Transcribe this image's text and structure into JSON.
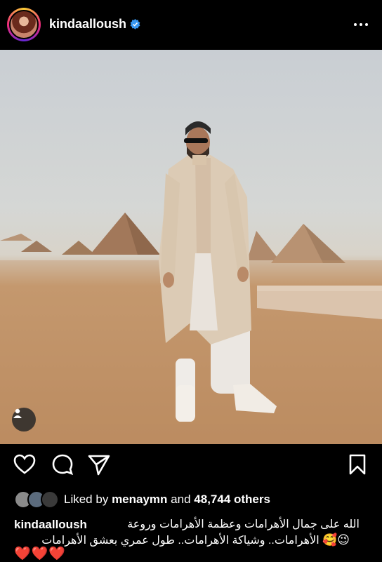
{
  "header": {
    "username": "kindaalloush",
    "verified_icon": "verified-badge-icon",
    "more_icon": "more-options-icon"
  },
  "post": {
    "photo_description_icon": "user-tag-icon"
  },
  "actions": {
    "like_icon": "heart-icon",
    "comment_icon": "comment-icon",
    "share_icon": "send-icon",
    "save_icon": "bookmark-icon"
  },
  "likes": {
    "prefix": "Liked by",
    "user": "menaymn",
    "middle": "and",
    "count": "48,744 others"
  },
  "caption": {
    "username": "kindaalloush",
    "line1": "الله على جمال الأهرامات وعظمة الأهرامات وروعة",
    "line2": "الأهرامات.. وشياكة الأهرامات.. طول عمري بعشق الأهرامات",
    "emojis": "😉🥰",
    "hearts": "❤️❤️❤️"
  },
  "colors": {
    "background": "#000000",
    "verified": "#3897f0",
    "text": "#ffffff"
  }
}
